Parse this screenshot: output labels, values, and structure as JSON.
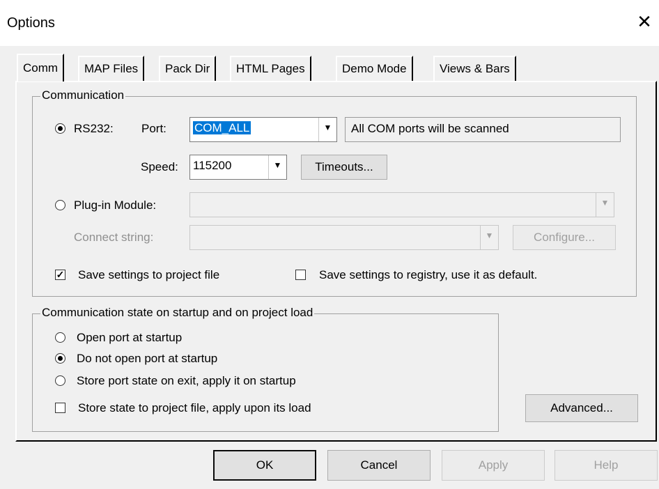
{
  "window": {
    "title": "Options",
    "close_glyph": "✕"
  },
  "tabs": [
    "Comm",
    "MAP Files",
    "Pack Dir",
    "HTML Pages",
    "Demo Mode",
    "Views & Bars"
  ],
  "communication": {
    "group_label": "Communication",
    "rs232_label": "RS232:",
    "port_label": "Port:",
    "port_value": "COM_ALL",
    "port_info": "All COM ports will be scanned",
    "speed_label": "Speed:",
    "speed_value": "115200",
    "timeouts_button": "Timeouts...",
    "plugin_label": "Plug-in Module:",
    "connect_label": "Connect string:",
    "configure_button": "Configure...",
    "save_project": "Save settings to project file",
    "save_registry": "Save settings to registry, use it as default.",
    "dropdown_glyph": "▼"
  },
  "startup": {
    "group_label": "Communication state on startup and on project load",
    "open_port": "Open port at startup",
    "do_not_open": "Do not open port at startup",
    "store_port": "Store port state on exit, apply it on startup",
    "store_state": "Store state to project file, apply upon its load",
    "advanced_button": "Advanced..."
  },
  "buttons": {
    "ok": "OK",
    "cancel": "Cancel",
    "apply": "Apply",
    "help": "Help"
  },
  "state": {
    "rs232_selected": true,
    "plugin_selected": false,
    "save_project_checked": true,
    "save_registry_checked": false,
    "startup_option_selected": "Do not open port at startup",
    "store_state_checked": false
  }
}
